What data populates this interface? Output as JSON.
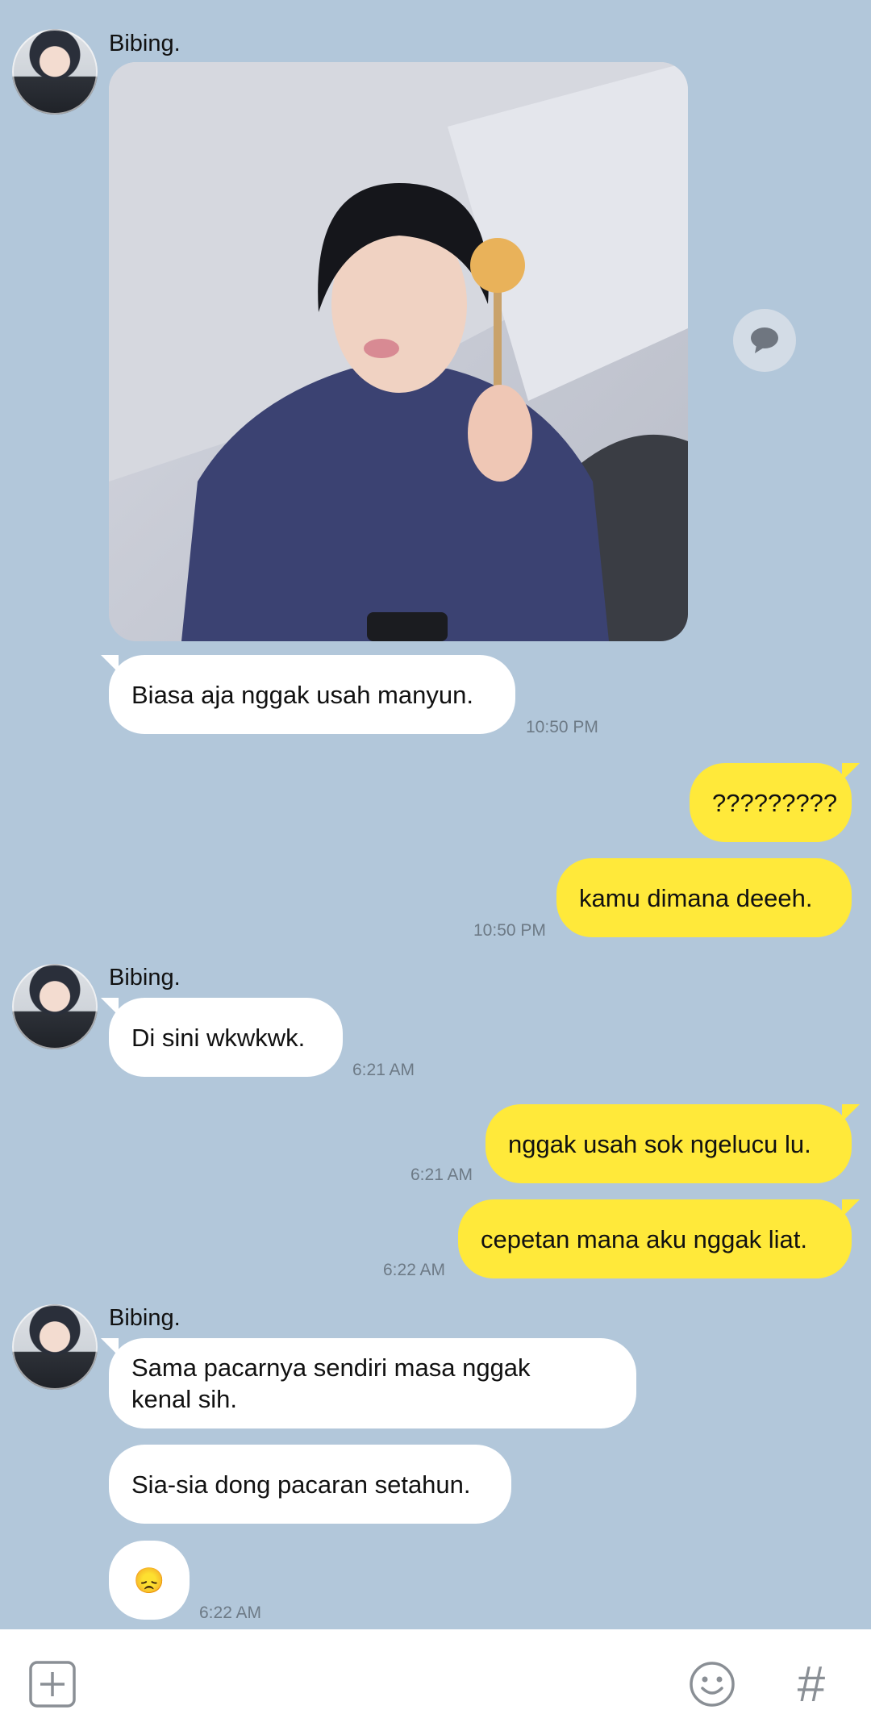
{
  "sender_name": "Bibing.",
  "messages": {
    "m1_text": "Biasa aja nggak usah manyun.",
    "m1_time": "10:50 PM",
    "m2_text": "?????????",
    "m3_text": "kamu dimana deeeh.",
    "m3_time": "10:50 PM",
    "m4_text": "Di sini wkwkwk.",
    "m4_time": "6:21 AM",
    "m5_text": "nggak usah sok ngelucu lu.",
    "m5_time": "6:21 AM",
    "m6_text": "cepetan mana aku nggak liat.",
    "m6_time": "6:22 AM",
    "m7_text": "Sama pacarnya sendiri masa nggak kenal sih.",
    "m8_text": "Sia-sia dong pacaran setahun.",
    "m9_text": "😞",
    "m9_time": "6:22 AM"
  },
  "input_bar": {
    "add_icon": "plus-square-icon",
    "emoji_icon": "smiley-icon",
    "hashtag_label": "#"
  },
  "colors": {
    "background": "#b2c7da",
    "outgoing_bubble": "#ffe93a",
    "incoming_bubble": "#ffffff"
  }
}
